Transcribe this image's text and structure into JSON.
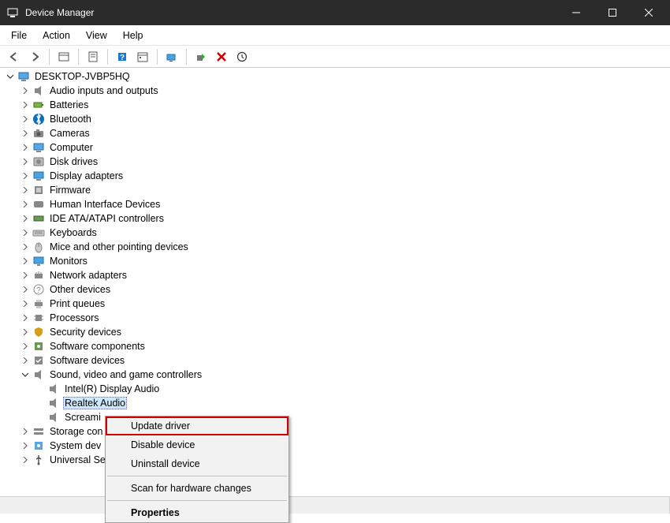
{
  "window": {
    "title": "Device Manager"
  },
  "menu": {
    "file": "File",
    "action": "Action",
    "view": "View",
    "help": "Help"
  },
  "root": {
    "name": "DESKTOP-JVBP5HQ"
  },
  "categories": [
    {
      "label": "Audio inputs and outputs",
      "icon": "speaker"
    },
    {
      "label": "Batteries",
      "icon": "battery"
    },
    {
      "label": "Bluetooth",
      "icon": "bluetooth"
    },
    {
      "label": "Cameras",
      "icon": "camera"
    },
    {
      "label": "Computer",
      "icon": "computer"
    },
    {
      "label": "Disk drives",
      "icon": "disk"
    },
    {
      "label": "Display adapters",
      "icon": "display"
    },
    {
      "label": "Firmware",
      "icon": "firmware"
    },
    {
      "label": "Human Interface Devices",
      "icon": "hid"
    },
    {
      "label": "IDE ATA/ATAPI controllers",
      "icon": "ide"
    },
    {
      "label": "Keyboards",
      "icon": "keyboard"
    },
    {
      "label": "Mice and other pointing devices",
      "icon": "mouse"
    },
    {
      "label": "Monitors",
      "icon": "monitor"
    },
    {
      "label": "Network adapters",
      "icon": "network"
    },
    {
      "label": "Other devices",
      "icon": "other"
    },
    {
      "label": "Print queues",
      "icon": "printer"
    },
    {
      "label": "Processors",
      "icon": "cpu"
    },
    {
      "label": "Security devices",
      "icon": "security"
    },
    {
      "label": "Software components",
      "icon": "swcomp"
    },
    {
      "label": "Software devices",
      "icon": "swdev"
    }
  ],
  "sound_category": {
    "label": "Sound, video and game controllers",
    "icon": "speaker"
  },
  "sound_children": [
    {
      "label": "Intel(R) Display Audio"
    },
    {
      "label": "Realtek Audio",
      "selected": true
    },
    {
      "label": "Screami"
    }
  ],
  "after_categories": [
    {
      "label": "Storage con",
      "icon": "storage"
    },
    {
      "label": "System dev",
      "icon": "system"
    },
    {
      "label": "Universal Se",
      "icon": "usb"
    }
  ],
  "context_menu": {
    "update": "Update driver",
    "disable": "Disable device",
    "uninstall": "Uninstall device",
    "scan": "Scan for hardware changes",
    "properties": "Properties"
  }
}
